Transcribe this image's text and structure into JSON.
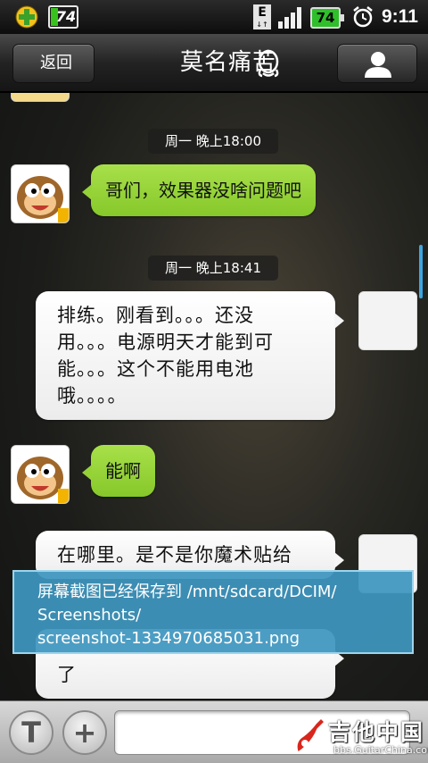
{
  "status_bar": {
    "battery_small_label": "74",
    "network_type": "E",
    "battery_label": "74",
    "time": "9:11"
  },
  "header": {
    "back_label": "返回",
    "title": "莫名痛苦"
  },
  "chat": {
    "timestamps": [
      "周一 晚上18:00",
      "周一 晚上18:41"
    ],
    "messages": [
      {
        "side": "left",
        "text": "哥们，效果器没啥问题吧"
      },
      {
        "side": "right",
        "lines": [
          "排练。刚看到。。。还没",
          "用。。。电源明天才能到可",
          "能。。。这个不能用电池",
          "哦。。。。"
        ]
      },
      {
        "side": "left",
        "text": "能啊"
      },
      {
        "side": "right",
        "lines": [
          "在哪里。是不是你魔术贴给"
        ]
      },
      {
        "side": "right",
        "lines": [
          "了"
        ]
      }
    ]
  },
  "toast": {
    "lines": [
      "屏幕截图已经保存到 /mnt/sdcard/DCIM/",
      "Screenshots/",
      "screenshot-1334970685031.png"
    ]
  },
  "input_bar": {
    "text_button_icon": "T",
    "plus_button_icon": "+",
    "input_value": ""
  },
  "watermark": {
    "title": "吉他中国",
    "url": "bbs.GuitarChina.com"
  },
  "colors": {
    "green_bubble": "#94d236",
    "toast_bg": "#3e96be",
    "scroll_indicator": "#3da4e0"
  }
}
